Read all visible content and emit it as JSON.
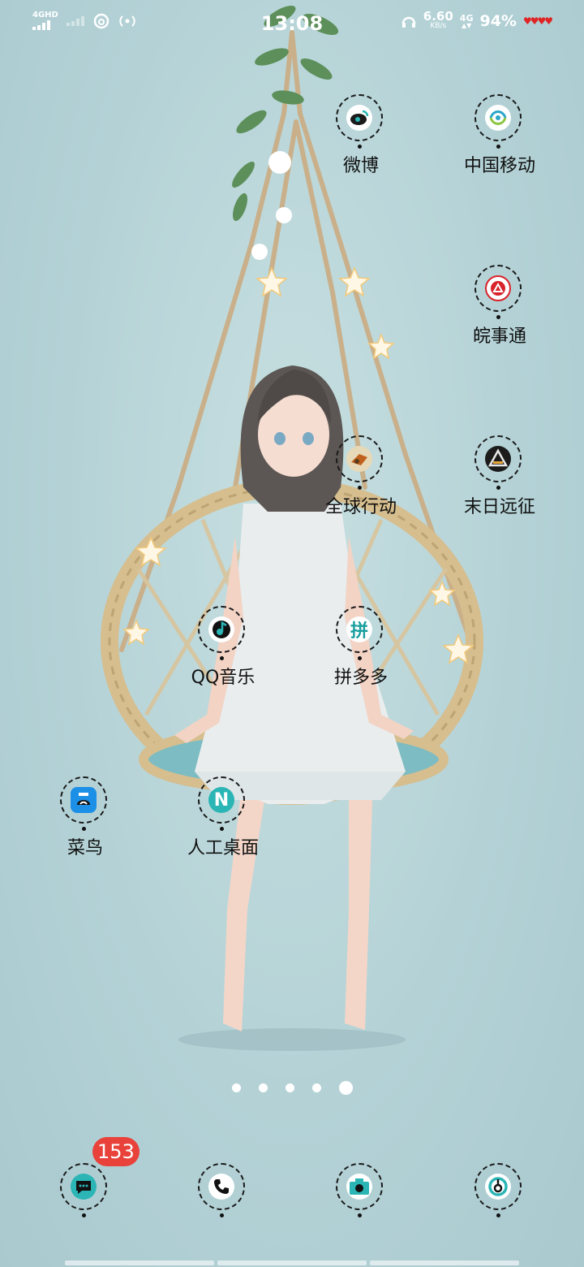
{
  "status_bar": {
    "sim1_tag": "4GHD",
    "time": "13:08",
    "speed_value": "6.60",
    "speed_unit": "KB/s",
    "network": "4G",
    "battery": "94%"
  },
  "apps": [
    {
      "id": "weibo",
      "label": "微博",
      "icon": "weibo-icon"
    },
    {
      "id": "china-mobile",
      "label": "中国移动",
      "icon": "china-mobile-icon"
    },
    {
      "id": "wanshitong",
      "label": "皖事通",
      "icon": "wanshitong-icon"
    },
    {
      "id": "global-action",
      "label": "全球行动",
      "icon": "global-action-icon"
    },
    {
      "id": "doomsday",
      "label": "末日远征",
      "icon": "doomsday-icon"
    },
    {
      "id": "qq-music",
      "label": "QQ音乐",
      "icon": "qq-music-icon"
    },
    {
      "id": "pinduoduo",
      "label": "拼多多",
      "icon": "pinduoduo-icon"
    },
    {
      "id": "cainiao",
      "label": "菜鸟",
      "icon": "cainiao-icon"
    },
    {
      "id": "ai-desktop",
      "label": "人工桌面",
      "icon": "ai-desktop-icon"
    }
  ],
  "pager": {
    "count": 5,
    "active": 5
  },
  "dock": {
    "messages_badge": "153",
    "items": [
      {
        "id": "messages",
        "icon": "message-icon"
      },
      {
        "id": "phone",
        "icon": "phone-icon"
      },
      {
        "id": "camera",
        "icon": "camera-icon"
      },
      {
        "id": "netease-music",
        "icon": "netease-music-icon"
      }
    ]
  },
  "colors": {
    "background": "#b4d2d6",
    "accent": "#1fb0b0",
    "badge": "#e8423a"
  }
}
